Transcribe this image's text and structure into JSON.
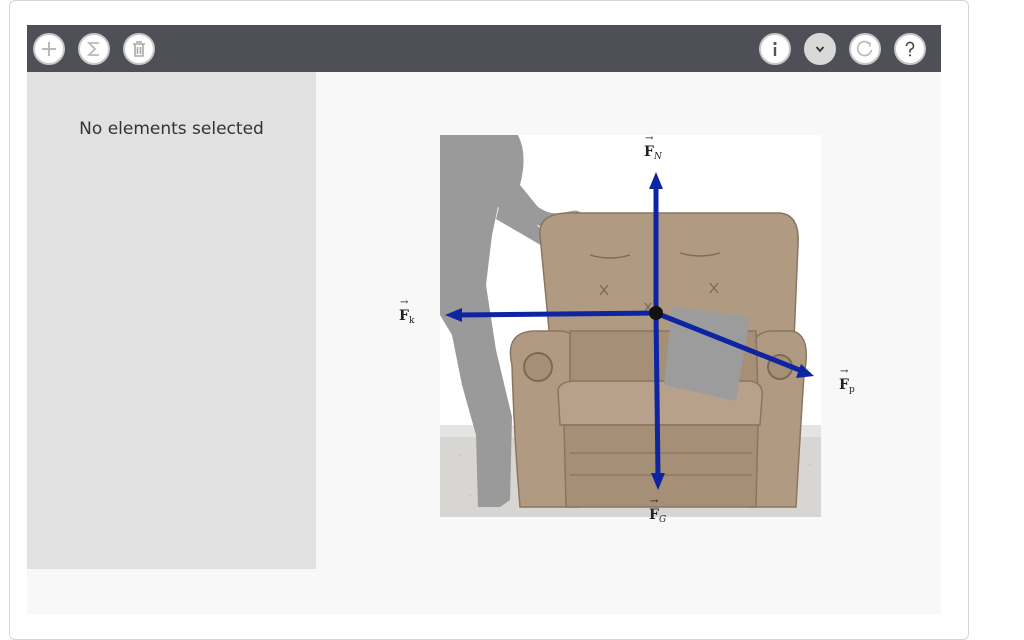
{
  "toolbar": {
    "left_buttons": [
      {
        "name": "add",
        "icon": "plus-icon"
      },
      {
        "name": "sum",
        "icon": "sigma-icon"
      },
      {
        "name": "delete",
        "icon": "trash-icon"
      }
    ],
    "right_buttons": [
      {
        "name": "info",
        "icon": "info-icon"
      },
      {
        "name": "menu",
        "icon": "chevron-down-icon"
      },
      {
        "name": "reset",
        "icon": "reset-icon"
      },
      {
        "name": "help",
        "icon": "question-icon"
      }
    ]
  },
  "sidebar": {
    "message": "No elements selected"
  },
  "diagram": {
    "forces": [
      {
        "id": "normal",
        "symbol": "F",
        "subscript": "N",
        "direction": "up"
      },
      {
        "id": "friction",
        "symbol": "F",
        "subscript": "k",
        "direction": "left"
      },
      {
        "id": "push",
        "symbol": "F",
        "subscript": "p",
        "direction": "down-right"
      },
      {
        "id": "gravity",
        "symbol": "F",
        "subscript": "G",
        "direction": "down"
      }
    ]
  },
  "colors": {
    "toolbar_bg": "#4f4f57",
    "sidebar_bg": "#e1e1e1",
    "canvas_bg": "#f8f8f8",
    "vector": "#0d24a3",
    "chair": "#b09a82"
  }
}
